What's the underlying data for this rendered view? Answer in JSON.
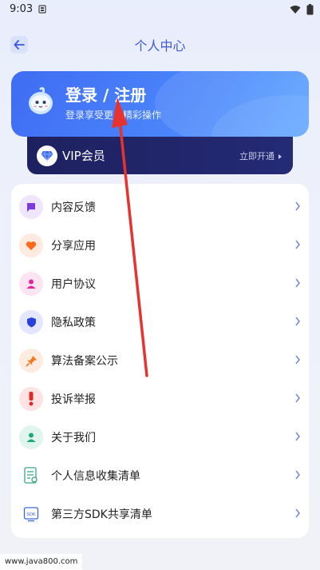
{
  "status_bar": {
    "time": "9:03"
  },
  "header": {
    "title": "个人中心"
  },
  "login_card": {
    "title": "登录 / 注册",
    "subtitle": "登录享受更多精彩操作"
  },
  "vip": {
    "label": "VIP会员",
    "action": "立即开通"
  },
  "menu": {
    "items": [
      {
        "label": "内容反馈",
        "icon": "chat-bubble-icon",
        "color": "#7a3ce0",
        "bg": "#efe6fd"
      },
      {
        "label": "分享应用",
        "icon": "heart-icon",
        "color": "#ff6a1a",
        "bg": "#ffeadf"
      },
      {
        "label": "用户协议",
        "icon": "user-icon",
        "color": "#e2279a",
        "bg": "#fde4f2"
      },
      {
        "label": "隐私政策",
        "icon": "shield-icon",
        "color": "#2b3fd9",
        "bg": "#e3e7fd"
      },
      {
        "label": "算法备案公示",
        "icon": "pin-icon",
        "color": "#f07a20",
        "bg": "#fdebe0"
      },
      {
        "label": "投诉举报",
        "icon": "exclamation-icon",
        "color": "#e02a2a",
        "bg": "#fde3e3"
      },
      {
        "label": "关于我们",
        "icon": "person-icon",
        "color": "#1ea87a",
        "bg": "#dff5ed"
      },
      {
        "label": "个人信息收集清单",
        "icon": "document-list-icon",
        "color": "#3aa787",
        "bg": "transparent"
      },
      {
        "label": "第三方SDK共享清单",
        "icon": "sdk-icon",
        "color": "#3a67d6",
        "bg": "transparent"
      }
    ]
  },
  "watermark": {
    "text": "www.java800.com"
  },
  "colors": {
    "accent": "#3f57e0",
    "vip_bg": "#1e2160",
    "annotation_arrow": "#e8322e"
  }
}
